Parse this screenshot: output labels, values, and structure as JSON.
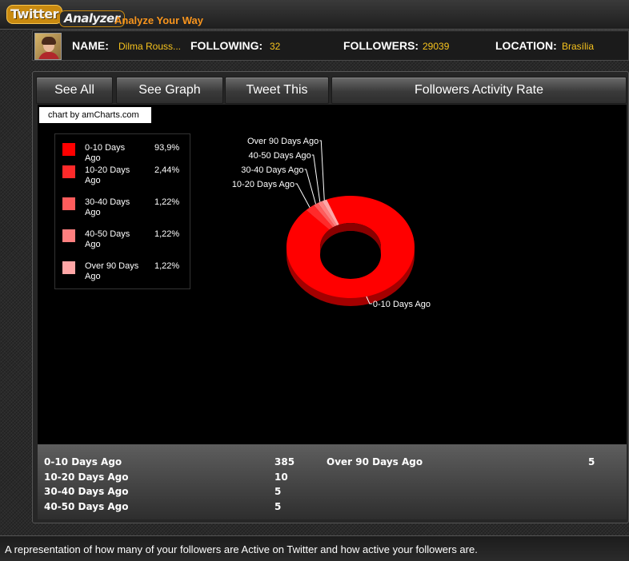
{
  "app": {
    "logo_line1": "Twitter",
    "logo_line2": "Analyzer",
    "tagline": "Analyze Your Way"
  },
  "profile": {
    "name_label": "NAME:",
    "name_value": "Dilma Rouss...",
    "following_label": "FOLLOWING:",
    "following_value": "32",
    "followers_label": "FOLLOWERS:",
    "followers_value": "29039",
    "location_label": "LOCATION:",
    "location_value": "Brasília"
  },
  "tabs": [
    {
      "label": "See All"
    },
    {
      "label": "See Graph"
    },
    {
      "label": "Tweet This"
    },
    {
      "label": "Followers Activity Rate"
    }
  ],
  "chart_credit": "chart by amCharts.com",
  "legend": [
    {
      "name": "0-10 Days Ago",
      "pct": "93,9%",
      "color": "#ff0000"
    },
    {
      "name": "10-20 Days Ago",
      "pct": "2,44%",
      "color": "#ff2a2a"
    },
    {
      "name": "30-40 Days Ago",
      "pct": "1,22%",
      "color": "#ff5c5c"
    },
    {
      "name": "40-50 Days Ago",
      "pct": "1,22%",
      "color": "#ff7f7f"
    },
    {
      "name": "Over 90 Days Ago",
      "pct": "1,22%",
      "color": "#ffa6a6"
    }
  ],
  "chart_data": {
    "type": "pie",
    "categories": [
      "0-10 Days Ago",
      "10-20 Days Ago",
      "30-40 Days Ago",
      "40-50 Days Ago",
      "Over 90 Days Ago"
    ],
    "values": [
      385,
      10,
      5,
      5,
      5
    ],
    "colors": [
      "#ff0000",
      "#ff2a2a",
      "#ff5c5c",
      "#ff7f7f",
      "#ffa6a6"
    ],
    "donut": true,
    "legend": "left"
  },
  "stats": [
    {
      "label": "0-10 Days Ago",
      "value": "385"
    },
    {
      "label": "10-20 Days Ago",
      "value": "10"
    },
    {
      "label": "30-40 Days Ago",
      "value": "5"
    },
    {
      "label": "40-50 Days Ago",
      "value": "5"
    },
    {
      "label": "Over 90 Days Ago",
      "value": "5"
    }
  ],
  "footer_text": "A representation of how many of your followers are Active on Twitter and how active your followers are."
}
